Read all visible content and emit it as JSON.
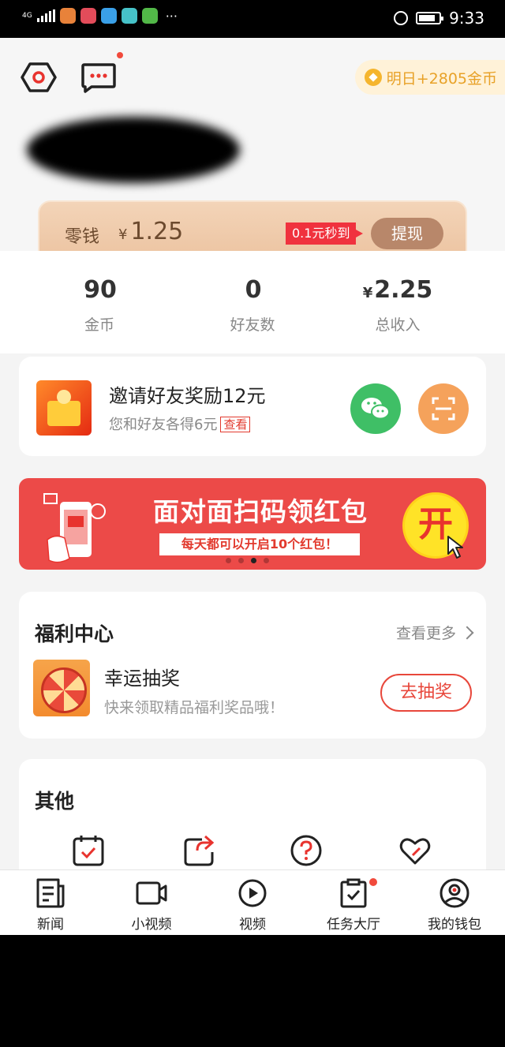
{
  "status_bar": {
    "network": "4G",
    "time": "9:33",
    "overflow": "···",
    "app_icon_colors": [
      "#e8823a",
      "#e34c5a",
      "#3aa0e8",
      "#46c2c8",
      "#52b848"
    ]
  },
  "header": {
    "coin_bonus": "明日+2805金币"
  },
  "balance": {
    "label": "零钱",
    "currency": "¥",
    "amount": "1.25",
    "tag": "0.1元秒到",
    "withdraw_label": "提现"
  },
  "stats": [
    {
      "value": "90",
      "currency": "",
      "label": "金币"
    },
    {
      "value": "0",
      "currency": "",
      "label": "好友数"
    },
    {
      "value": "2.25",
      "currency": "¥",
      "label": "总收入"
    }
  ],
  "invite": {
    "title": "邀请好友奖励12元",
    "subtitle": "您和好友各得6元",
    "view_label": "查看"
  },
  "banner": {
    "title": "面对面扫码领红包",
    "subtitle": "每天都可以开启10个红包！",
    "open_label": "开",
    "active_dot": 3,
    "dot_count": 4
  },
  "welfare": {
    "title": "福利中心",
    "more_label": "查看更多",
    "item_title": "幸运抽奖",
    "item_subtitle": "快来领取精品福利奖品哦！",
    "button_label": "去抽奖"
  },
  "other": {
    "title": "其他"
  },
  "bottom_nav": [
    {
      "label": "新闻",
      "icon": "news-icon"
    },
    {
      "label": "小视频",
      "icon": "short-video-icon"
    },
    {
      "label": "视频",
      "icon": "video-play-icon"
    },
    {
      "label": "任务大厅",
      "icon": "task-clipboard-icon",
      "badge": true
    },
    {
      "label": "我的钱包",
      "icon": "wallet-profile-icon",
      "active": true
    }
  ],
  "colors": {
    "accent_red": "#e8473b",
    "balance_card": "#ecc3a0",
    "wechat_green": "#3fbf66",
    "scan_orange": "#f5a25b",
    "banner_red": "#ec4a48",
    "coin_gold": "#e8a228"
  }
}
